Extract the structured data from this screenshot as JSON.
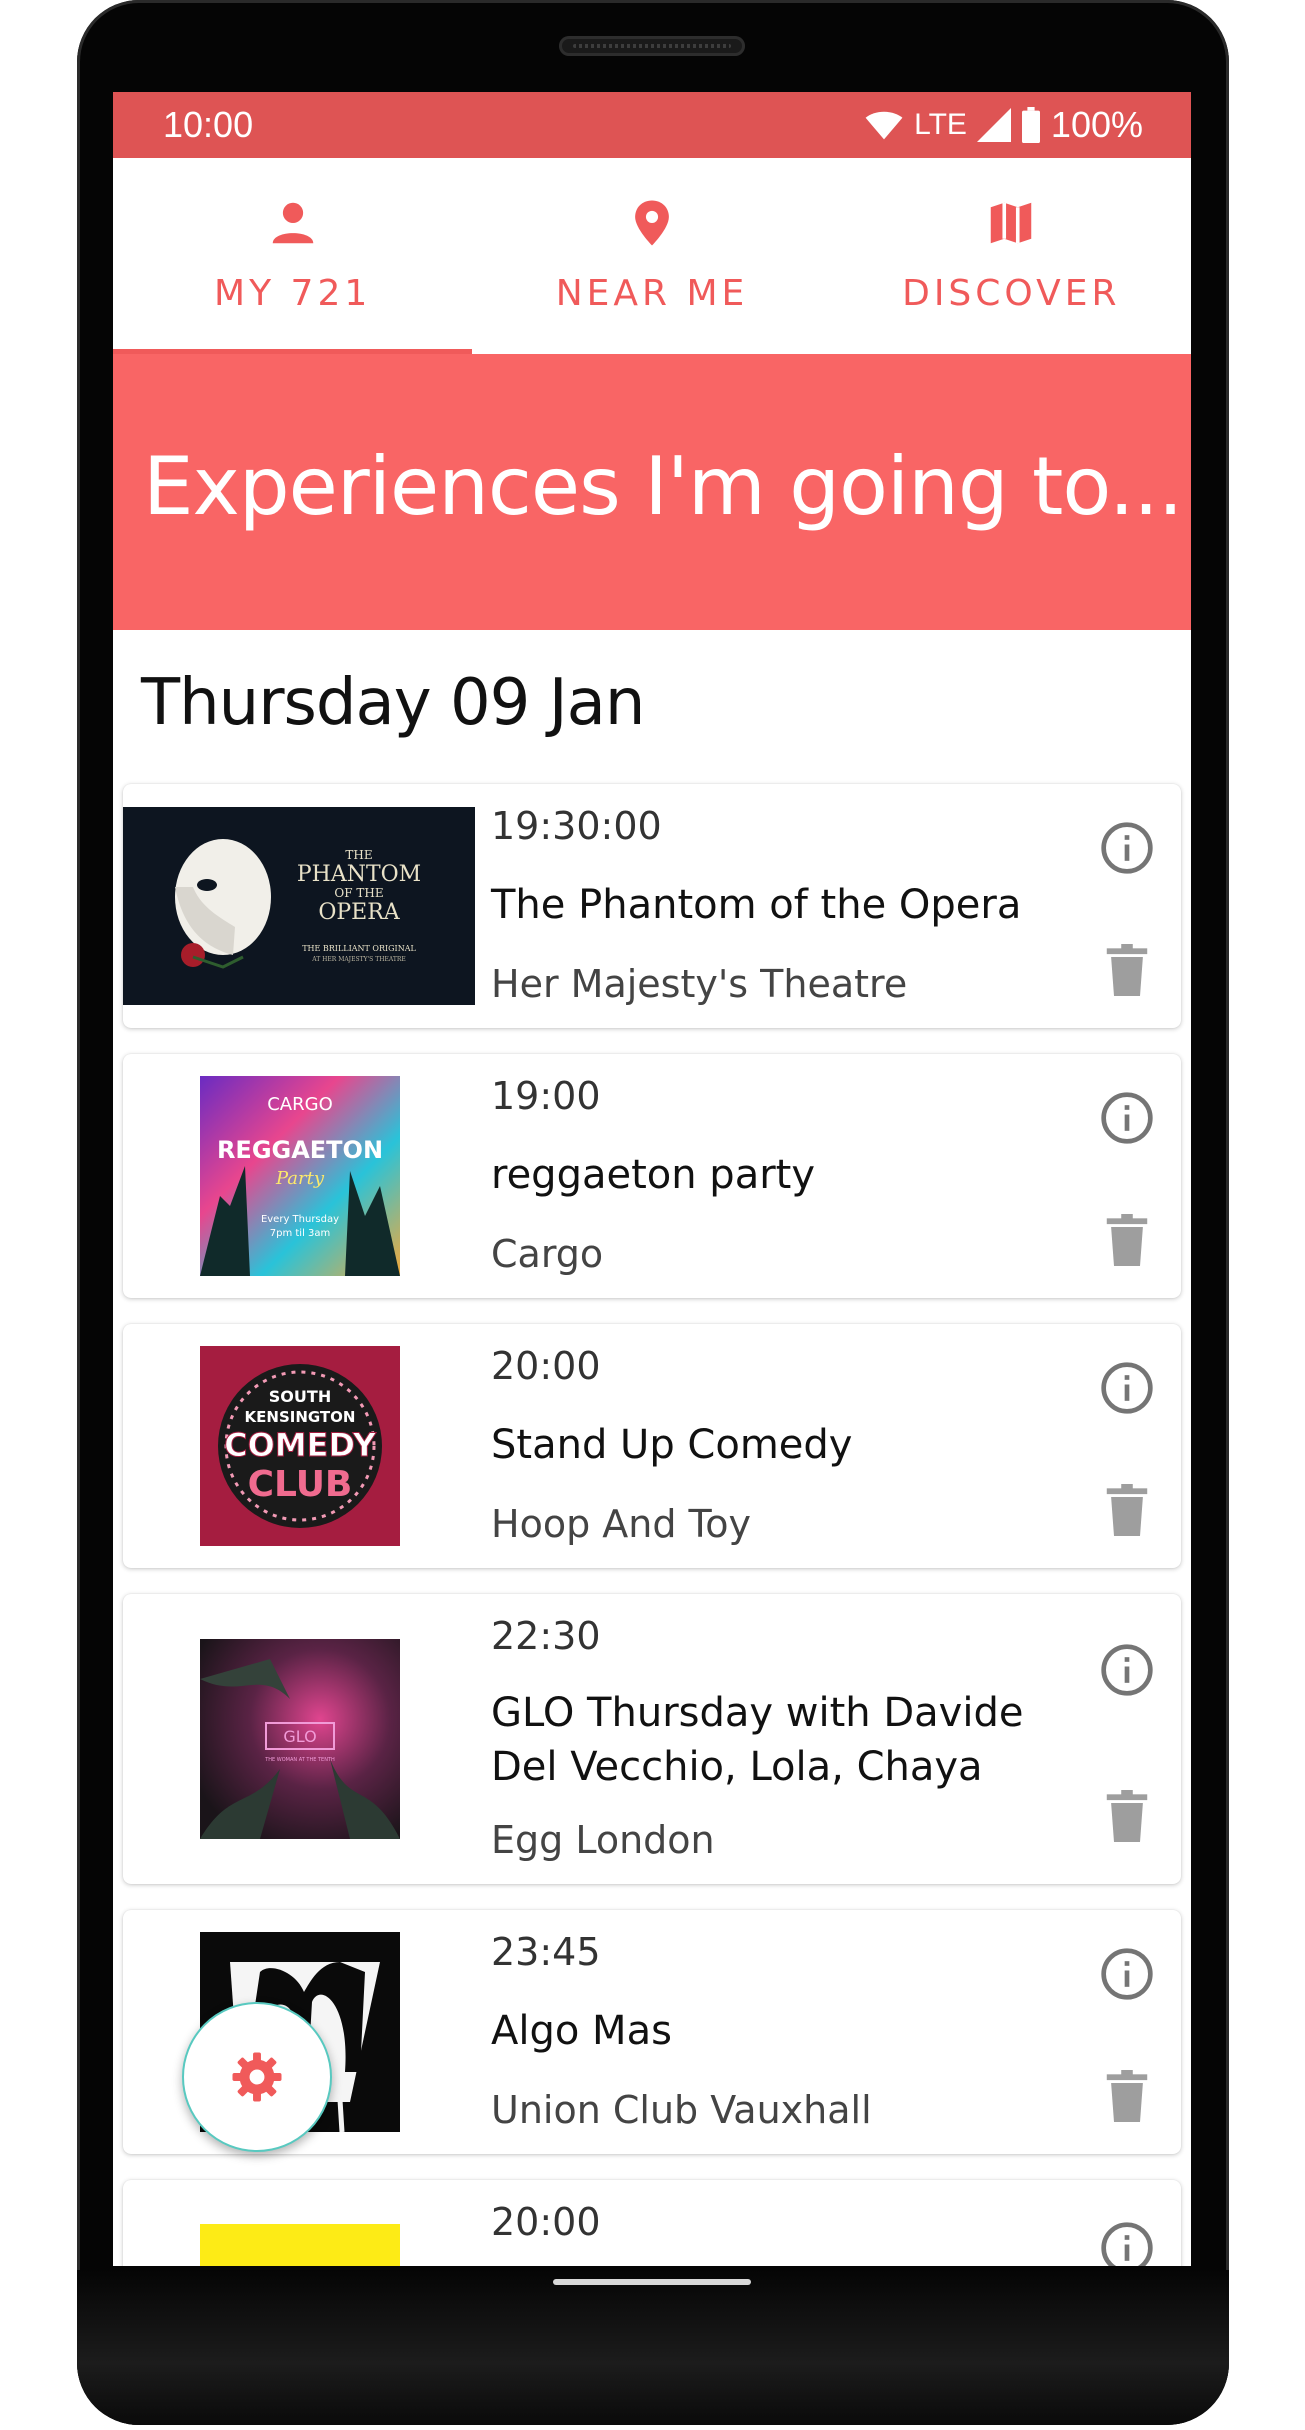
{
  "status": {
    "time": "10:00",
    "network": "LTE",
    "battery": "100%"
  },
  "tabs": [
    {
      "label": "MY 721",
      "icon": "person-icon",
      "active": true
    },
    {
      "label": "NEAR ME",
      "icon": "location-pin-icon",
      "active": false
    },
    {
      "label": "DISCOVER",
      "icon": "map-icon",
      "active": false
    }
  ],
  "hero": {
    "title": "Experiences I'm going to..."
  },
  "date_header": "Thursday 09 Jan",
  "events": [
    {
      "time": "19:30:00",
      "name": "The Phantom of the Opera",
      "venue": "Her Majesty's Theatre",
      "poster": {
        "line1": "THE",
        "line2": "PHANTOM",
        "line3": "OF THE",
        "line4": "OPERA",
        "line5": "THE BRILLIANT ORIGINAL",
        "line6": "AT HER MAJESTY'S THEATRE"
      }
    },
    {
      "time": "19:00",
      "name": "reggaeton party",
      "venue": "Cargo",
      "poster": {
        "line1": "CARGO",
        "line2": "REGGAETON",
        "line3": "Party",
        "line4": "Every Thursday",
        "line5": "7pm til 3am"
      }
    },
    {
      "time": "20:00",
      "name": "Stand Up Comedy",
      "venue": "Hoop And Toy",
      "poster": {
        "line1": "SOUTH",
        "line2": "KENSINGTON",
        "line3": "COMEDY",
        "line4": "CLUB"
      }
    },
    {
      "time": "22:30",
      "name": "GLO Thursday with Davide Del Vecchio, Lola, Chaya",
      "venue": "Egg London",
      "poster": {
        "line1": "GLO",
        "line2": "THE WOMAN AT THE TENTH"
      }
    },
    {
      "time": "23:45",
      "name": "Algo Mas",
      "venue": "Union Club Vauxhall",
      "poster": {}
    },
    {
      "time": "20:00",
      "name": "",
      "venue": "",
      "poster": {}
    }
  ],
  "colors": {
    "accent": "#f05a5a",
    "statusbar": "#de5454",
    "hero": "#f96565",
    "fab_border": "#58c9c0",
    "icon_grey": "#757575"
  }
}
